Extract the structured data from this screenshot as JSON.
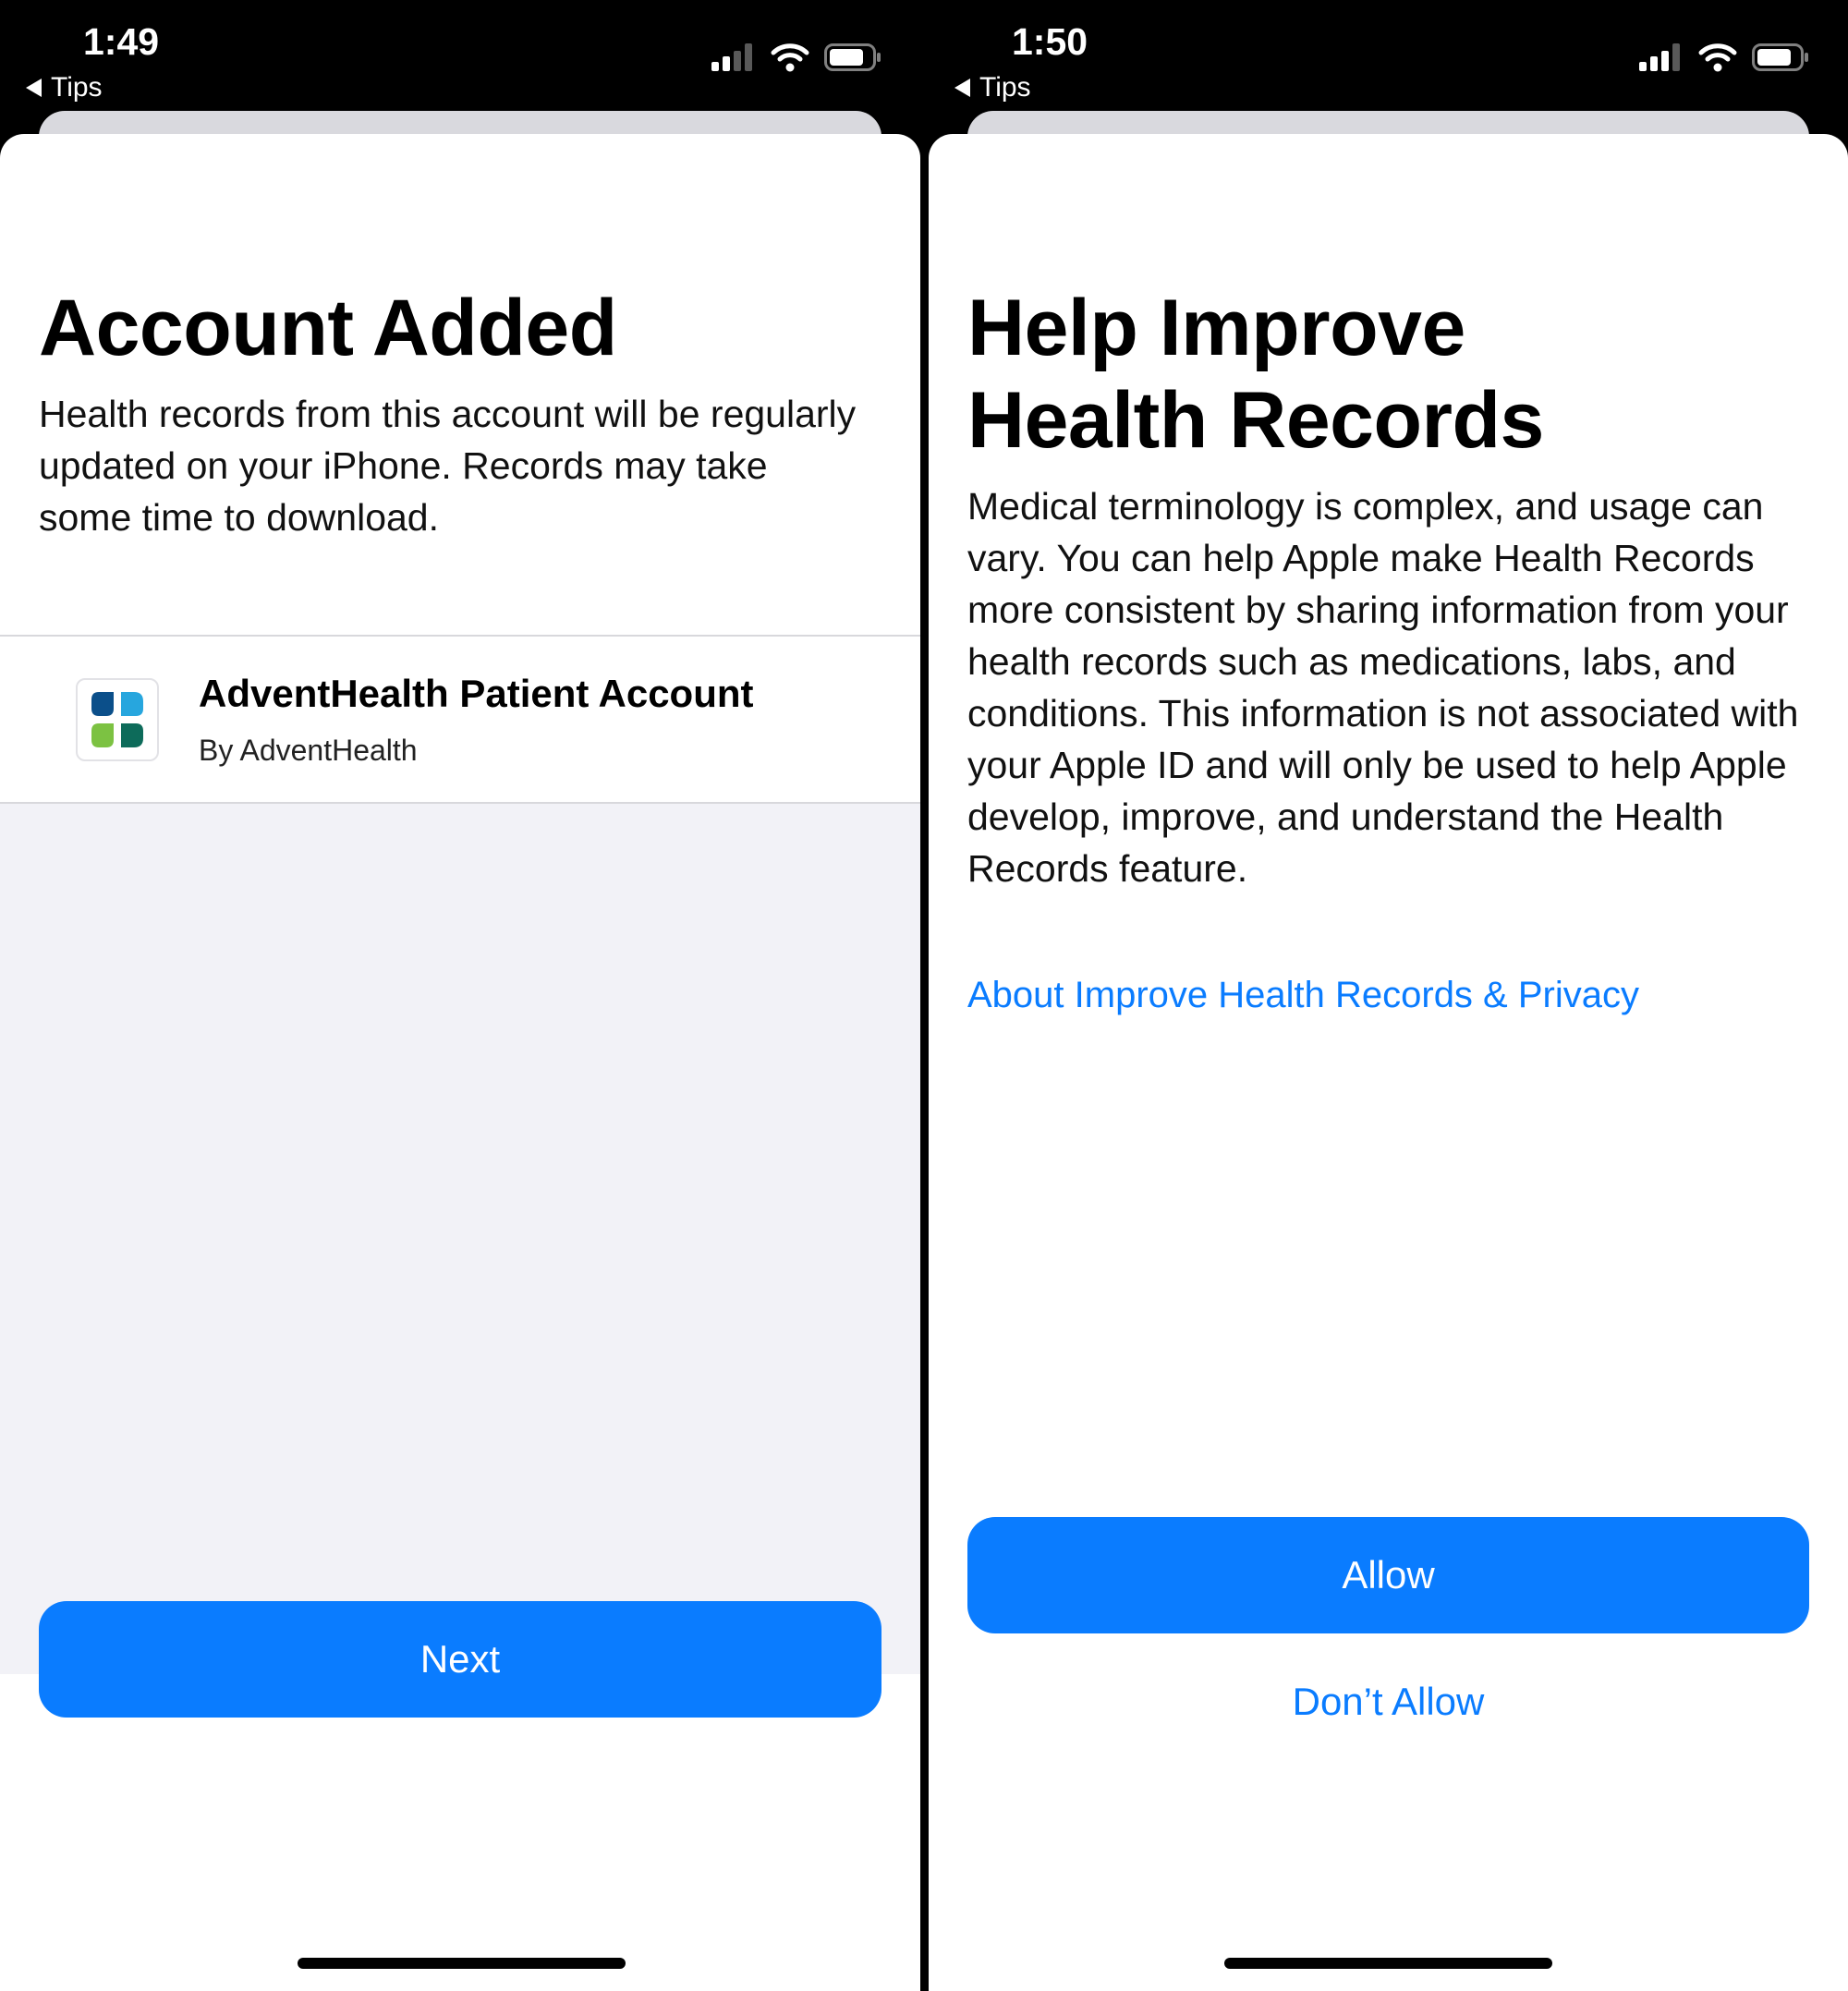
{
  "left": {
    "status": {
      "time": "1:49",
      "back_label": "Tips"
    },
    "title": "Account Added",
    "body": "Health records from this account will be regularly updated on your iPhone. Records may take some time to download.",
    "account": {
      "name": "AdventHealth Patient Account",
      "provider": "By AdventHealth",
      "icon": "adventhealth-logo"
    },
    "next_label": "Next"
  },
  "right": {
    "status": {
      "time": "1:50",
      "back_label": "Tips"
    },
    "title_line1": "Help Improve",
    "title_line2": "Health Records",
    "body": "Medical terminology is complex, and usage can vary. You can help Apple make Health Records more consistent by sharing information from your health records such as medications, labs, and conditions. This information is not associated with your Apple ID and will only be used to help Apple develop, improve, and understand the Health Records feature.",
    "privacy_link": "About Improve Health Records & Privacy",
    "allow_label": "Allow",
    "dont_allow_label": "Don’t Allow"
  },
  "colors": {
    "accent": "#0a7cff",
    "grouped_background": "#f2f2f7",
    "status_bar": "#000000"
  }
}
